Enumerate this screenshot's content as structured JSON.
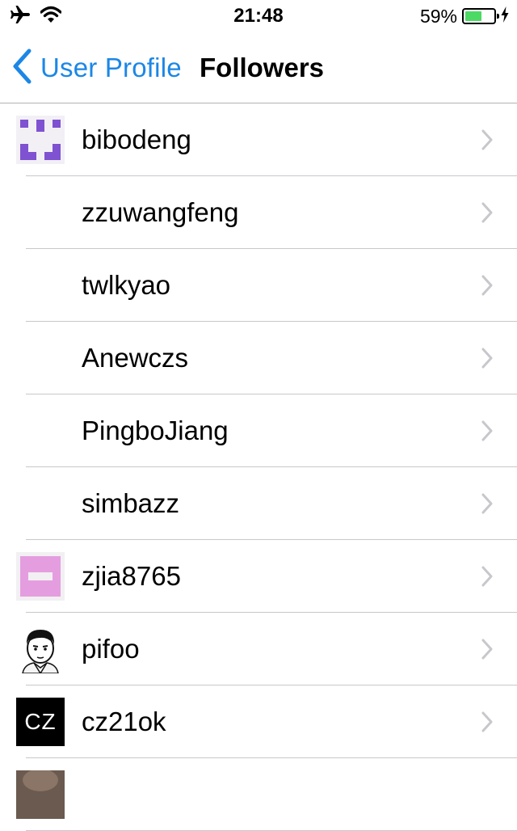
{
  "status_bar": {
    "time": "21:48",
    "battery_percent_text": "59%",
    "battery_level": 0.59,
    "battery_color": "#4cd964",
    "icons": [
      "airplane-icon",
      "wifi-icon",
      "charging-bolt-icon"
    ]
  },
  "nav": {
    "back_label": "User Profile",
    "title": "Followers",
    "accent_color": "#1b87e6"
  },
  "followers": [
    {
      "name": "bibodeng",
      "avatar": "identicon-purple"
    },
    {
      "name": "zzuwangfeng",
      "avatar": "none"
    },
    {
      "name": "twlkyao",
      "avatar": "none"
    },
    {
      "name": "Anewczs",
      "avatar": "none"
    },
    {
      "name": "PingboJiang",
      "avatar": "none"
    },
    {
      "name": "simbazz",
      "avatar": "none"
    },
    {
      "name": "zjia8765",
      "avatar": "identicon-pink"
    },
    {
      "name": "pifoo",
      "avatar": "cartoon-face"
    },
    {
      "name": "cz21ok",
      "avatar": "text",
      "avatar_text": "CZ"
    },
    {
      "name": "",
      "avatar": "photo"
    }
  ]
}
